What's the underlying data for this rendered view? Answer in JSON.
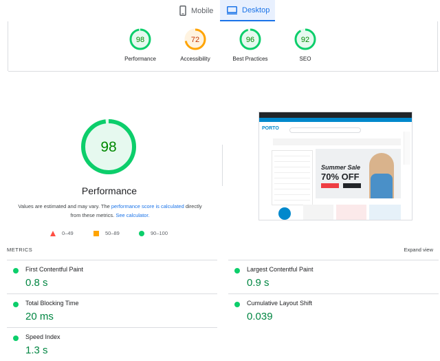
{
  "tabs": [
    {
      "label": "Mobile",
      "icon": "smartphone-icon",
      "active": false
    },
    {
      "label": "Desktop",
      "icon": "desktop-icon",
      "active": true
    }
  ],
  "categories": [
    {
      "score": "98",
      "label": "Performance",
      "color": "#0cce6b",
      "fill": 0.98
    },
    {
      "score": "72",
      "label": "Accessibility",
      "color": "#ffa400",
      "fill": 0.72
    },
    {
      "score": "96",
      "label": "Best Practices",
      "color": "#0cce6b",
      "fill": 0.96
    },
    {
      "score": "92",
      "label": "SEO",
      "color": "#0cce6b",
      "fill": 0.92
    }
  ],
  "main": {
    "score": "98",
    "fill": 0.98,
    "title": "Performance",
    "disclaimer_pre": "Values are estimated and may vary. The ",
    "disclaimer_link1": "performance score is calculated",
    "disclaimer_mid": " directly from these metrics. ",
    "disclaimer_link2": "See calculator."
  },
  "legend": [
    {
      "range": "0–49",
      "shape": "triangle",
      "color": "#ff4e42"
    },
    {
      "range": "50–89",
      "shape": "square",
      "color": "#ffa400"
    },
    {
      "range": "90–100",
      "shape": "circle",
      "color": "#0cce6b"
    }
  ],
  "thumbnail": {
    "logo": "PORTO",
    "hero_line1": "Summer Sale",
    "hero_line2": "70% OFF"
  },
  "metrics": {
    "header": "METRICS",
    "expand": "Expand view",
    "items": [
      {
        "name": "First Contentful Paint",
        "value": "0.8 s"
      },
      {
        "name": "Largest Contentful Paint",
        "value": "0.9 s"
      },
      {
        "name": "Total Blocking Time",
        "value": "20 ms"
      },
      {
        "name": "Cumulative Layout Shift",
        "value": "0.039"
      },
      {
        "name": "Speed Index",
        "value": "1.3 s"
      }
    ]
  },
  "colors": {
    "pass": "#0cce6b",
    "average": "#ffa400",
    "fail": "#ff4e42",
    "link": "#1a73e8"
  }
}
